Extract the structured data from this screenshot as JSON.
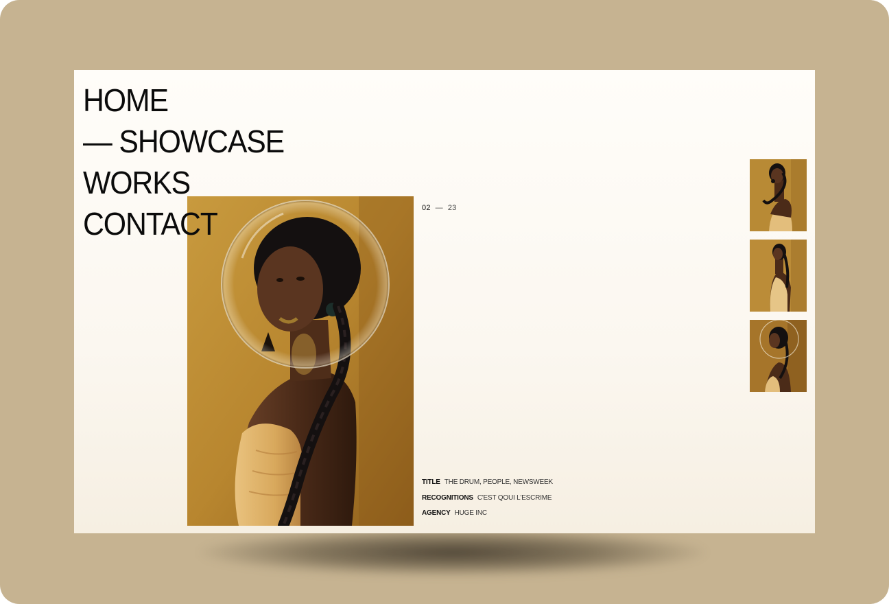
{
  "nav": {
    "items": [
      {
        "label": "HOME"
      },
      {
        "label": "— SHOWCASE"
      },
      {
        "label": "WORKS"
      },
      {
        "label": "CONTACT"
      }
    ]
  },
  "counter": {
    "current": "02",
    "separator": "—",
    "total": "23"
  },
  "details": [
    {
      "key": "TITLE",
      "value": "THE DRUM, PEOPLE, NEWSWEEK"
    },
    {
      "key": "RECOGNITIONS",
      "value": "C'EST QOUI L'ESCRIME"
    },
    {
      "key": "AGENCY",
      "value": "HUGE INC"
    }
  ],
  "colors": {
    "page_background": "#c6b391",
    "screen_background": "#fffdf9",
    "text": "#0b0b0b",
    "photo_background": "#b8862f"
  },
  "thumbnails": [
    {
      "pose": "smiling-holding-braid"
    },
    {
      "pose": "standing-side"
    },
    {
      "pose": "profile-with-bubble"
    }
  ]
}
